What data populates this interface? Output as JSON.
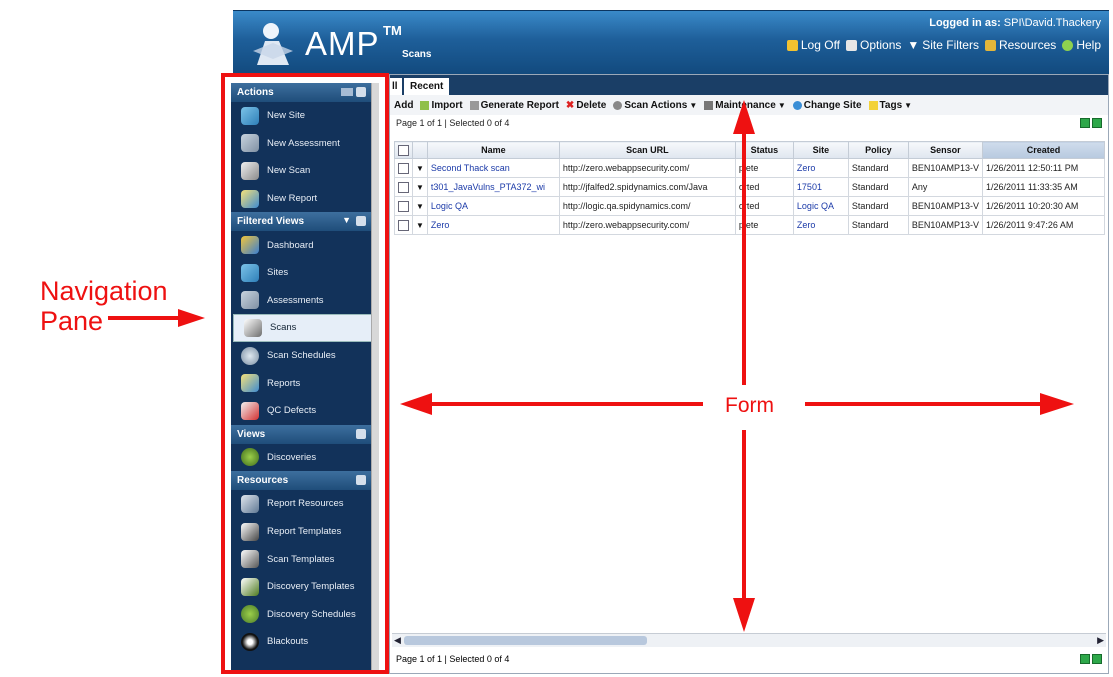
{
  "annotations": {
    "nav_label": "Navigation\nPane",
    "form_label": "Form"
  },
  "header": {
    "app_name": "AMP",
    "trademark": "TM",
    "section": "Scans",
    "logged_in_label": "Logged in as:",
    "logged_in_user": "SPI\\David.Thackery",
    "links": [
      "Log Off",
      "Options",
      "Site Filters",
      "Resources",
      "Help"
    ]
  },
  "sidebar": {
    "actions": {
      "title": "Actions",
      "items": [
        "New Site",
        "New Assessment",
        "New Scan",
        "New Report"
      ]
    },
    "filtered_views": {
      "title": "Filtered Views",
      "items": [
        "Dashboard",
        "Sites",
        "Assessments",
        "Scans",
        "Scan Schedules",
        "Reports",
        "QC Defects"
      ],
      "active": "Scans"
    },
    "views": {
      "title": "Views",
      "items": [
        "Discoveries"
      ]
    },
    "resources": {
      "title": "Resources",
      "items": [
        "Report Resources",
        "Report Templates",
        "Scan Templates",
        "Discovery Templates",
        "Discovery Schedules",
        "Blackouts"
      ]
    }
  },
  "main": {
    "tabs": [
      "ll",
      "Recent"
    ],
    "toolbar": [
      "Add",
      "Import",
      "Generate Report",
      "Delete",
      "Scan Actions",
      "Maintenance",
      "Change Site",
      "Tags"
    ],
    "pager_text": "Page 1 of 1  |  Selected 0 of 4",
    "columns": [
      "",
      "",
      "Name",
      "Scan URL",
      "Status",
      "Site",
      "Policy",
      "Sensor",
      "Created"
    ],
    "rows": [
      {
        "name": "Second Thack scan",
        "url": "http://zero.webappsecurity.com/",
        "status": "plete",
        "site": "Zero",
        "policy": "Standard",
        "sensor": "BEN10AMP13-V",
        "created": "1/26/2011 12:50:11 PM"
      },
      {
        "name": "t301_JavaVulns_PTA372_wi",
        "url": "http://jfalfed2.spidynamics.com/Java",
        "status": "orted",
        "site": "17501",
        "policy": "Standard",
        "sensor": "Any",
        "created": "1/26/2011 11:33:35 AM"
      },
      {
        "name": "Logic QA",
        "url": "http://logic.qa.spidynamics.com/",
        "status": "orted",
        "site": "Logic QA",
        "policy": "Standard",
        "sensor": "BEN10AMP13-V",
        "created": "1/26/2011 10:20:30 AM"
      },
      {
        "name": "Zero",
        "url": "http://zero.webappsecurity.com/",
        "status": "plete",
        "site": "Zero",
        "policy": "Standard",
        "sensor": "BEN10AMP13-V",
        "created": "1/26/2011 9:47:26 AM"
      }
    ],
    "pager_bottom": "Page 1 of 1  |  Selected 0 of 4"
  },
  "colors": {
    "annotation": "#ee1111",
    "sidebar_bg": "#12325a",
    "header_top": "#3a8ac9",
    "link": "#1b3aa8"
  }
}
